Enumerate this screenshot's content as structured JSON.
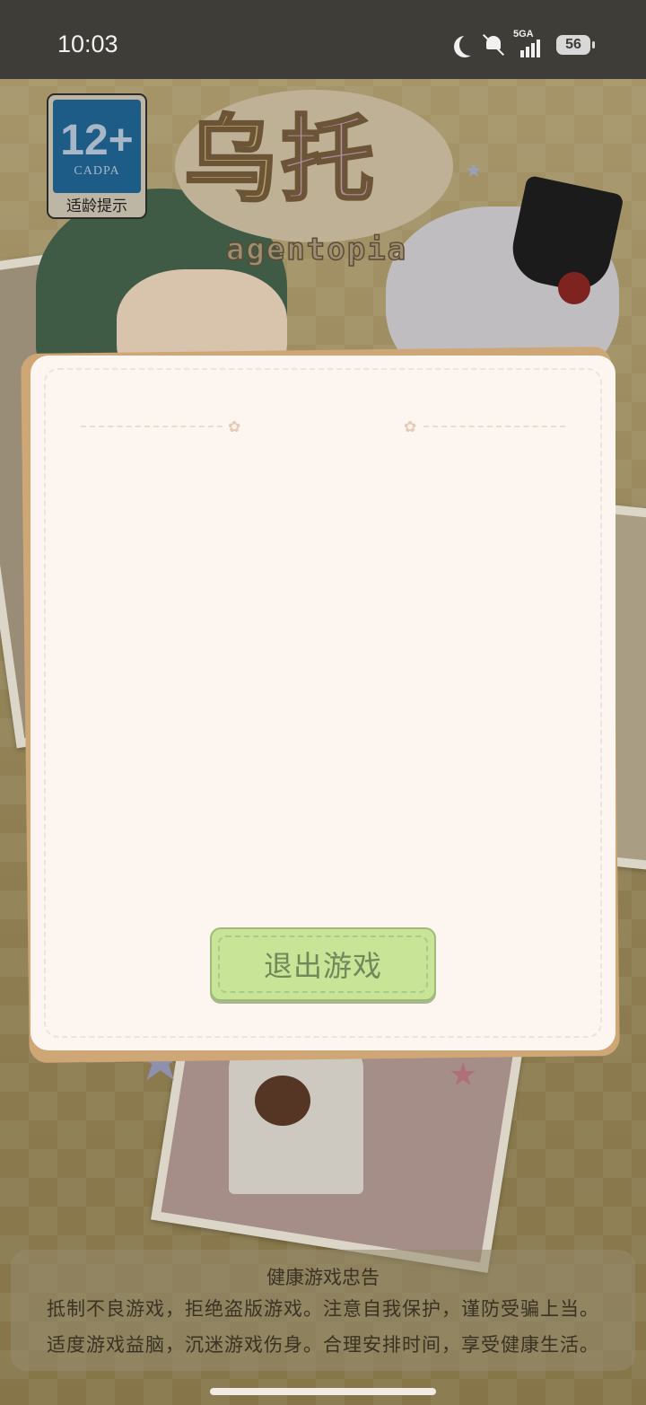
{
  "status_bar": {
    "time": "10:03",
    "network": "5GA",
    "battery": "56",
    "icons": [
      "moon-icon",
      "mute-bell-icon",
      "signal-icon",
      "battery-icon"
    ]
  },
  "age_rating": {
    "rating": "12+",
    "org": "CADPA",
    "caption": "适龄提示"
  },
  "logo": {
    "title_char1": "乌",
    "title_char2": "托",
    "subtitle": "agentopia"
  },
  "dialog": {
    "exit_button_label": "退出游戏"
  },
  "health_notice": {
    "title": "健康游戏忠告",
    "lines": [
      "抵制不良游戏，拒绝盗版游戏。注意自我保护，谨防受骗上当。",
      "适度游戏益脑，沉迷游戏伤身。合理安排时间，享受健康生活。"
    ]
  },
  "colors": {
    "dialog_background": "#fdf5ef",
    "dialog_border": "#cfa776",
    "exit_button": "#c7e497",
    "exit_button_text": "#71885a",
    "status_bar": "#3e3d38"
  }
}
